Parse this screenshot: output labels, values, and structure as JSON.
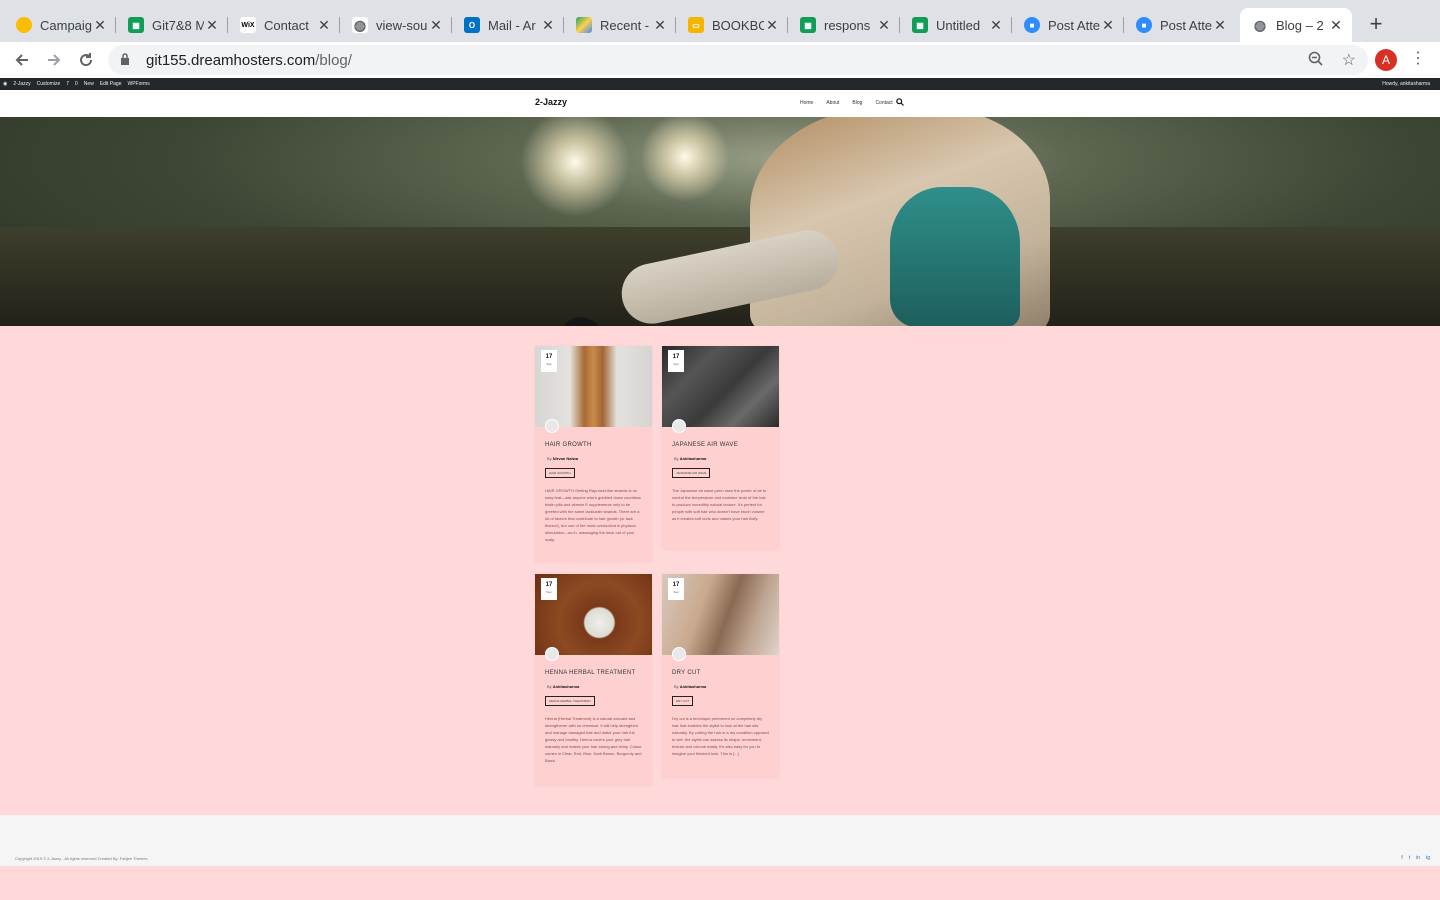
{
  "browser": {
    "tabs": [
      {
        "title": "Campaig",
        "icon": "chrome-icon",
        "color": "#fbbc04"
      },
      {
        "title": "Git7&8 M",
        "icon": "sheets-icon",
        "color": "#0f9d58"
      },
      {
        "title": "Contact",
        "icon": "wix-icon",
        "color": "#000000"
      },
      {
        "title": "view-sou",
        "icon": "globe-icon",
        "color": "#5f6368"
      },
      {
        "title": "Mail - Ar",
        "icon": "outlook-icon",
        "color": "#0072c6"
      },
      {
        "title": "Recent -",
        "icon": "drive-icon",
        "color": "#1fa463"
      },
      {
        "title": "BOOKBO",
        "icon": "slides-icon",
        "color": "#f4b400"
      },
      {
        "title": "respons",
        "icon": "sheets-icon",
        "color": "#0f9d58"
      },
      {
        "title": "Untitled",
        "icon": "sheets-icon",
        "color": "#0f9d58"
      },
      {
        "title": "Post Atte",
        "icon": "zoom-icon",
        "color": "#2d8cff"
      },
      {
        "title": "Post Atte",
        "icon": "zoom-icon",
        "color": "#2d8cff"
      },
      {
        "title": "Blog – 2",
        "icon": "globe-icon",
        "color": "#5f6368"
      }
    ],
    "url_host": "git155.dreamhosters.com",
    "url_path": "/blog/",
    "profile_initial": "A"
  },
  "wp_admin_bar": {
    "items": [
      "2-Jazzy",
      "Customize",
      "7",
      "0",
      "New",
      "Edit Page",
      "WPForms"
    ],
    "greeting": "Howdy, ankitasharma"
  },
  "site": {
    "title": "2-Jazzy",
    "nav": [
      "Home",
      "About",
      "Blog",
      "Contact"
    ]
  },
  "posts": [
    {
      "day": "17",
      "month": "Sep",
      "title": "HAIR GROWTH",
      "by_label": "By",
      "author": "Nirvan Nalwa",
      "category": "HAIR GROWTH",
      "excerpt": "HAIR GROWTH Getting Rapunzel-like strands is no easy feat—ask anyone who's gobbled down countless biotin pills and vitamin E supplements only to be greeted with the same lackluster strands. There are a lot of factors that contribute to hair growth (or lack thereof), but one of the most overlooked is physical stimulation—as in, massaging the heck out of your scalp."
    },
    {
      "day": "17",
      "month": "Sep",
      "title": "JAPANESE AIR WAVE",
      "by_label": "By",
      "author": "Ankitasharma",
      "category": "JAPANESE AIR WAVE",
      "excerpt": "The Japanese air wave perm uses the power of air to control the temperature and moisture level of the hair to produce incredibly natural texture. It's perfect for people with soft hair who doesn't have much volume as it creates soft curls and makes your hair fluffy."
    },
    {
      "day": "17",
      "month": "Sep",
      "title": "HENNA HERBAL TREATMENT",
      "by_label": "By",
      "author": "Ankitasharma",
      "category": "HENNA HERBAL TREATMENT",
      "excerpt": "Henna (Herbal Treatment) is a natural colorant and strengthener with no chemical. It will help strengthen and manage damaged hair and make your hair full, glossy and healthy. Henna covers your grey hair naturally and makes your hair strong and shiny. Colour comes in Clear, Red, Blue, Dark Brown, Burgundy and Black."
    },
    {
      "day": "17",
      "month": "Sep",
      "title": "DRY CUT",
      "by_label": "By",
      "author": "Ankitasharma",
      "category": "DRY CUT",
      "excerpt": "Dry cut is a technique performed on completely dry hair that enables the stylist to look at the hair sits naturally. By cutting the hair in a dry condition opposed to wet, the stylist can assess its shape, movement, texture and volume easily. It's also easy for you to imagine your finished look. This is [...]"
    }
  ],
  "footer": {
    "copyright": "Copyright 2019 © 2-Jazzy - All rights reserved   Created By: Fahjee Themes",
    "social": [
      "f",
      "t",
      "in",
      "ig"
    ]
  }
}
